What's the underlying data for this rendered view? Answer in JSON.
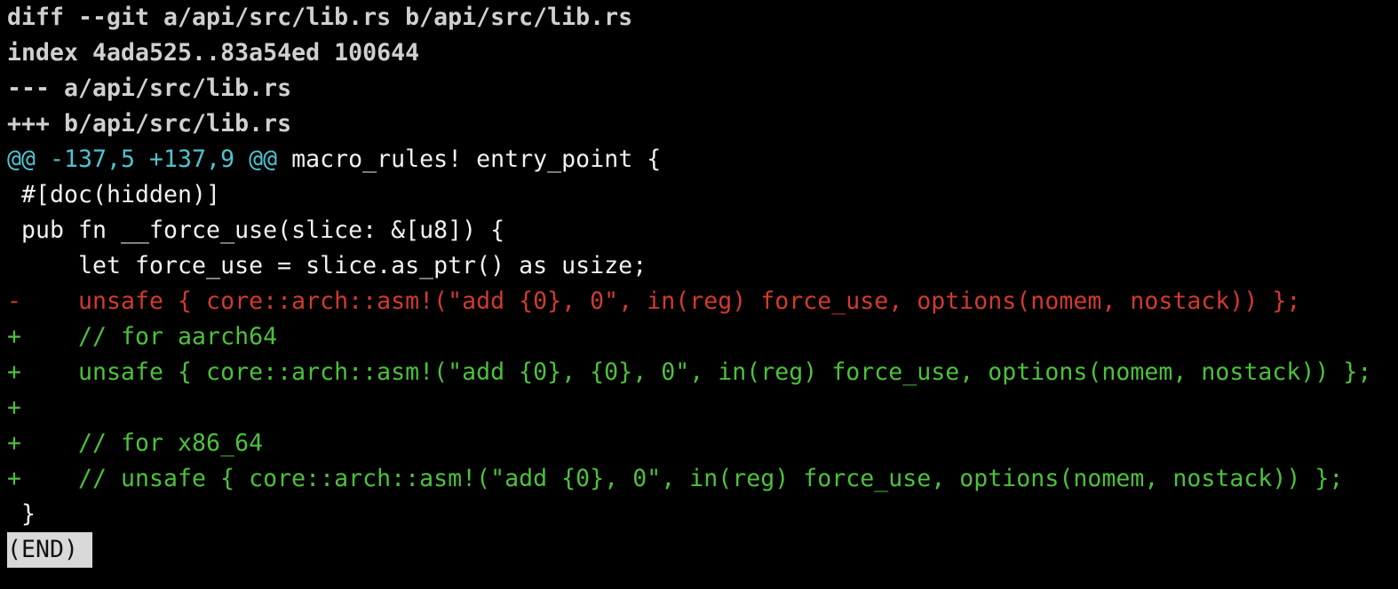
{
  "diff": {
    "header": [
      "diff --git a/api/src/lib.rs b/api/src/lib.rs",
      "index 4ada525..83a54ed 100644",
      "--- a/api/src/lib.rs",
      "+++ b/api/src/lib.rs"
    ],
    "hunk": {
      "range": "@@ -137,5 +137,9 @@",
      "context": " macro_rules! entry_point {"
    },
    "lines": [
      {
        "kind": "ctx",
        "text": " #[doc(hidden)]"
      },
      {
        "kind": "ctx",
        "text": " pub fn __force_use(slice: &[u8]) {"
      },
      {
        "kind": "ctx",
        "text": "     let force_use = slice.as_ptr() as usize;"
      },
      {
        "kind": "del",
        "text": "-    unsafe { core::arch::asm!(\"add {0}, 0\", in(reg) force_use, options(nomem, nostack)) };"
      },
      {
        "kind": "add",
        "text": "+    // for aarch64"
      },
      {
        "kind": "add",
        "text": "+    unsafe { core::arch::asm!(\"add {0}, {0}, 0\", in(reg) force_use, options(nomem, nostack)) };"
      },
      {
        "kind": "add",
        "text": "+"
      },
      {
        "kind": "add",
        "text": "+    // for x86_64"
      },
      {
        "kind": "add",
        "text": "+    // unsafe { core::arch::asm!(\"add {0}, 0\", in(reg) force_use, options(nomem, nostack)) };"
      },
      {
        "kind": "ctx",
        "text": " }"
      }
    ]
  },
  "pager": {
    "status": "(END)"
  },
  "colors": {
    "background": "#000000",
    "meta": "#d0d0d0",
    "hunk_range": "#4fc3cf",
    "deleted": "#d23a2f",
    "added": "#4cc23b",
    "pager_bg": "#d9d9d9"
  }
}
